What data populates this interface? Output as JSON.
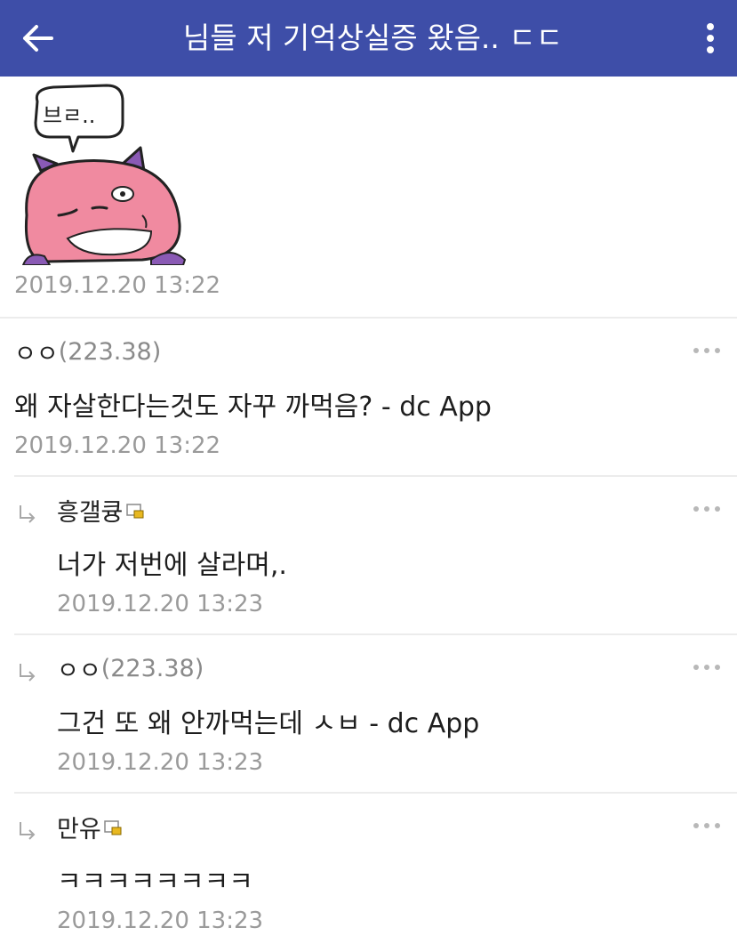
{
  "header": {
    "title": "님들 저 기억상실증 왔음.. ㄷㄷ",
    "background_color": "#3e4ea8",
    "back_icon": "arrow-left-icon",
    "menu_icon": "vertical-dots-icon"
  },
  "post": {
    "sticker_text": "브ㄹ..",
    "date": "2019.12.20 13:22"
  },
  "comments": [
    {
      "author": "ㅇㅇ",
      "ip": "(223.38)",
      "text": "왜 자살한다는것도 자꾸 까먹음? - dc App",
      "date": "2019.12.20 13:22",
      "is_reply": false,
      "has_badge": false
    },
    {
      "author": "흥갤큥",
      "ip": "",
      "text": "너가 저번에 살라며,.",
      "date": "2019.12.20 13:23",
      "is_reply": true,
      "has_badge": true
    },
    {
      "author": "ㅇㅇ",
      "ip": "(223.38)",
      "text": "그건 또 왜 안까먹는데 ㅅㅂ - dc App",
      "date": "2019.12.20 13:23",
      "is_reply": true,
      "has_badge": false
    },
    {
      "author": "만유",
      "ip": "",
      "text": "ㅋㅋㅋㅋㅋㅋㅋㅋ",
      "date": "2019.12.20 13:23",
      "is_reply": true,
      "has_badge": true
    }
  ]
}
